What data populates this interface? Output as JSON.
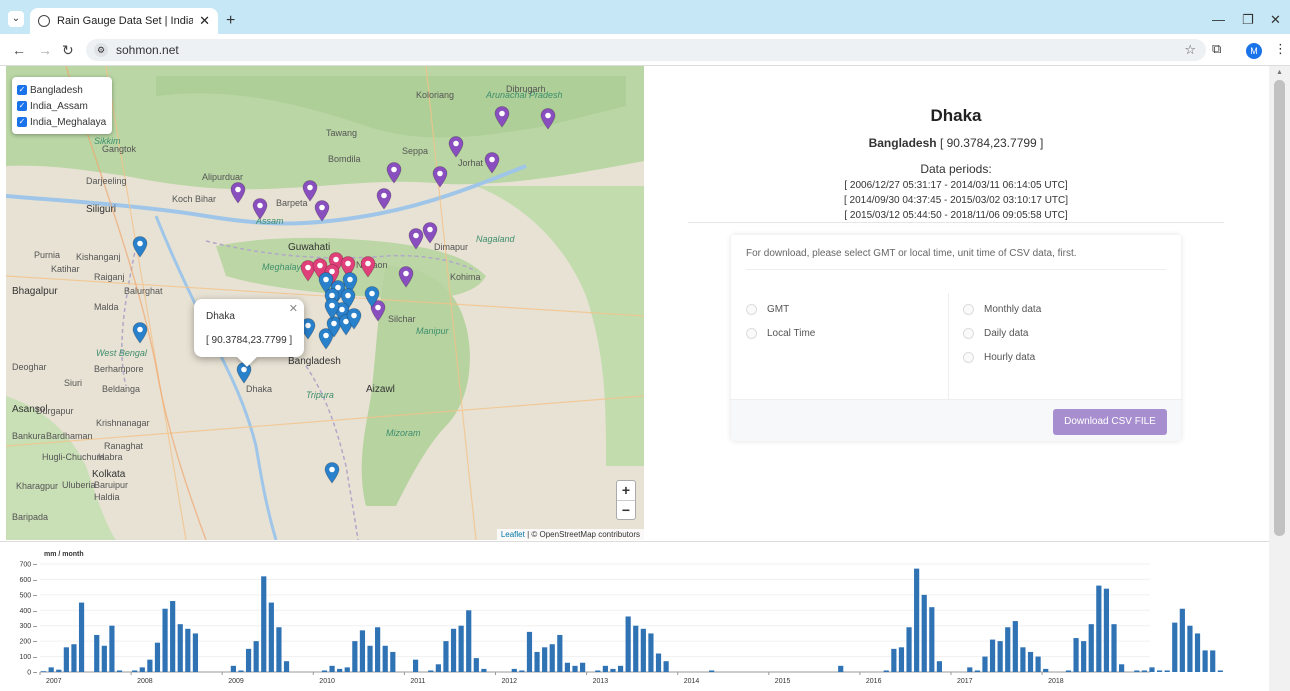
{
  "browser": {
    "tab_title": "Rain Gauge Data Set | India & |",
    "url": "sohmon.net",
    "profile_initial": "M"
  },
  "map": {
    "layers": [
      {
        "label": "Bangladesh",
        "checked": true
      },
      {
        "label": "India_Assam",
        "checked": true
      },
      {
        "label": "India_Meghalaya",
        "checked": true
      }
    ],
    "labels": [
      {
        "text": "Koloriang",
        "cls": ""
      },
      {
        "text": "Arunachal Pradesh",
        "cls": "region"
      },
      {
        "text": "Dibrugarh",
        "cls": ""
      },
      {
        "text": "Tawang",
        "cls": ""
      },
      {
        "text": "Seppa",
        "cls": ""
      },
      {
        "text": "Bomdila",
        "cls": ""
      },
      {
        "text": "Jorhat",
        "cls": ""
      },
      {
        "text": "Gangtok",
        "cls": ""
      },
      {
        "text": "Sikkim",
        "cls": "region"
      },
      {
        "text": "Darjeeling",
        "cls": ""
      },
      {
        "text": "Siliguri",
        "cls": "big"
      },
      {
        "text": "Alipurduar",
        "cls": ""
      },
      {
        "text": "Koch Bihar",
        "cls": ""
      },
      {
        "text": "Barpeta",
        "cls": ""
      },
      {
        "text": "Assam",
        "cls": "region"
      },
      {
        "text": "Guwahati",
        "cls": "big"
      },
      {
        "text": "Nagaon",
        "cls": ""
      },
      {
        "text": "Nagaland",
        "cls": "region"
      },
      {
        "text": "Dimapur",
        "cls": ""
      },
      {
        "text": "Kohima",
        "cls": ""
      },
      {
        "text": "Kishanganj",
        "cls": ""
      },
      {
        "text": "Purnia",
        "cls": ""
      },
      {
        "text": "Katihar",
        "cls": ""
      },
      {
        "text": "Raiganj",
        "cls": ""
      },
      {
        "text": "Bhagalpur",
        "cls": "big"
      },
      {
        "text": "Balurghat",
        "cls": ""
      },
      {
        "text": "Malda",
        "cls": ""
      },
      {
        "text": "Deoghar",
        "cls": ""
      },
      {
        "text": "West Bengal",
        "cls": "region"
      },
      {
        "text": "Berhampore",
        "cls": ""
      },
      {
        "text": "Siuri",
        "cls": ""
      },
      {
        "text": "Beldanga",
        "cls": ""
      },
      {
        "text": "Asansol",
        "cls": "big"
      },
      {
        "text": "Durgapur",
        "cls": ""
      },
      {
        "text": "Krishnanagar",
        "cls": ""
      },
      {
        "text": "Bankura",
        "cls": ""
      },
      {
        "text": "Bardhaman",
        "cls": ""
      },
      {
        "text": "Ranaghat",
        "cls": ""
      },
      {
        "text": "Hugli-Chuchura",
        "cls": ""
      },
      {
        "text": "Habra",
        "cls": ""
      },
      {
        "text": "Kolkata",
        "cls": "big"
      },
      {
        "text": "Kharagpur",
        "cls": ""
      },
      {
        "text": "Uluberia",
        "cls": ""
      },
      {
        "text": "Baruipur",
        "cls": ""
      },
      {
        "text": "Haldia",
        "cls": ""
      },
      {
        "text": "Baripada",
        "cls": ""
      },
      {
        "text": "Tripura",
        "cls": "region"
      },
      {
        "text": "Aizawl",
        "cls": "big"
      },
      {
        "text": "Mizoram",
        "cls": "region"
      },
      {
        "text": "Manipur",
        "cls": "region"
      },
      {
        "text": "Silchar",
        "cls": ""
      },
      {
        "text": "Dhaka",
        "cls": ""
      },
      {
        "text": "Bangladesh",
        "cls": "big"
      },
      {
        "text": "Meghalaya",
        "cls": "region"
      }
    ],
    "popup": {
      "name": "Dhaka",
      "coords": "[ 90.3784,23.7799 ]"
    },
    "zoom_in": "+",
    "zoom_out": "−",
    "attribution_leaflet": "Leaflet",
    "attribution_rest": " | © OpenStreetMap contributors",
    "pin_colors": {
      "Bangladesh": "#2a81cb",
      "India_Assam": "#8a4fbf",
      "India_Meghalaya": "#e0407a"
    }
  },
  "station": {
    "name": "Dhaka",
    "country": "Bangladesh",
    "coords": "[ 90.3784,23.7799 ]",
    "periods_heading": "Data periods:",
    "periods": [
      "[ 2006/12/27 05:31:17 - 2014/03/11 06:14:05 UTC]",
      "[ 2014/09/30 04:37:45 - 2015/03/02 03:10:17 UTC]",
      "[ 2015/03/12 05:44:50 - 2018/11/06 09:05:58 UTC]"
    ]
  },
  "download": {
    "hint": "For download, please select GMT or local time, unit time of CSV data, first.",
    "time_options": [
      "GMT",
      "Local Time"
    ],
    "unit_options": [
      "Monthly data",
      "Daily data",
      "Hourly data"
    ],
    "button_label": "Download CSV FILE"
  },
  "chart_data": {
    "type": "bar",
    "ylabel": "mm / month",
    "ylim": [
      0,
      700
    ],
    "yticks": [
      0,
      100,
      200,
      300,
      400,
      500,
      600,
      700
    ],
    "x_start": "2007-01",
    "xtick_labels": [
      "2007",
      "2008",
      "2009",
      "2010",
      "2011",
      "2012",
      "2013",
      "2014",
      "2015",
      "2016",
      "2017",
      "2018"
    ],
    "color": "#2f73b5",
    "values": [
      5,
      30,
      15,
      160,
      180,
      450,
      0,
      240,
      170,
      300,
      10,
      0,
      10,
      30,
      80,
      190,
      410,
      460,
      310,
      280,
      250,
      0,
      0,
      0,
      0,
      40,
      10,
      150,
      200,
      620,
      450,
      290,
      70,
      0,
      0,
      0,
      0,
      10,
      40,
      20,
      30,
      200,
      270,
      170,
      290,
      170,
      130,
      0,
      0,
      80,
      0,
      10,
      50,
      200,
      280,
      300,
      400,
      90,
      20,
      0,
      0,
      0,
      20,
      10,
      260,
      130,
      160,
      180,
      240,
      60,
      40,
      60,
      0,
      10,
      40,
      20,
      40,
      360,
      300,
      280,
      250,
      120,
      70,
      0,
      0,
      0,
      0,
      0,
      10,
      0,
      0,
      0,
      0,
      0,
      0,
      0,
      0,
      0,
      0,
      0,
      0,
      0,
      0,
      0,
      0,
      40,
      0,
      0,
      0,
      0,
      0,
      10,
      150,
      160,
      290,
      670,
      500,
      420,
      70,
      0,
      0,
      0,
      30,
      10,
      100,
      210,
      200,
      290,
      330,
      160,
      130,
      100,
      20,
      0,
      0,
      10,
      220,
      200,
      310,
      560,
      540,
      310,
      50,
      0,
      10,
      10,
      30,
      10,
      10,
      320,
      410,
      300,
      250,
      140,
      140,
      10
    ]
  }
}
